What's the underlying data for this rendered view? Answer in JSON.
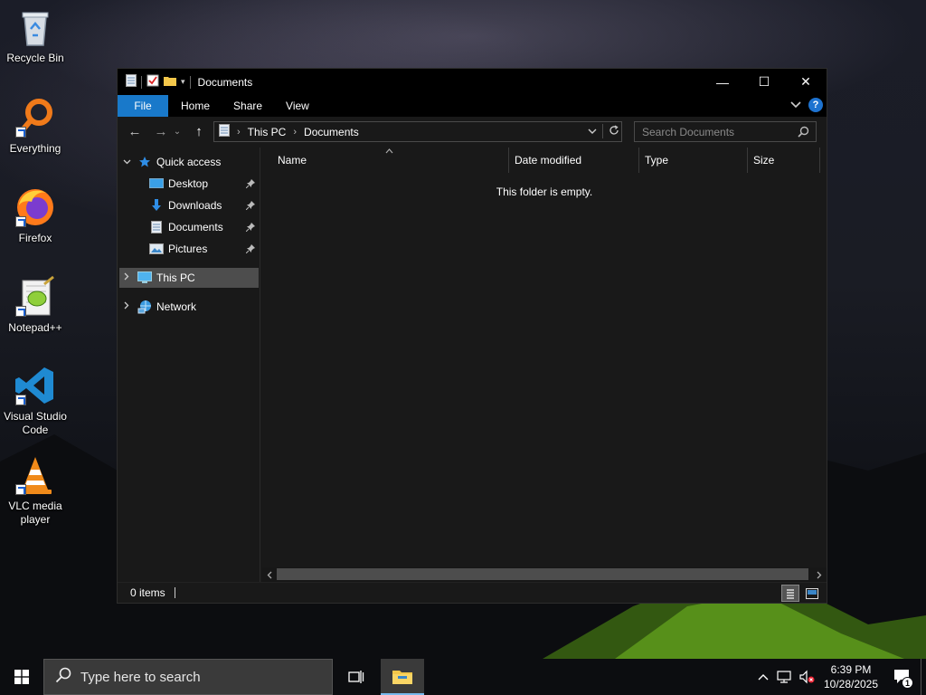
{
  "desktop": {
    "icons": [
      {
        "label": "Recycle Bin",
        "icon": "recycle-bin-icon"
      },
      {
        "label": "Everything",
        "icon": "everything-search-icon"
      },
      {
        "label": "Firefox",
        "icon": "firefox-icon"
      },
      {
        "label": "Notepad++",
        "icon": "notepad-plus-plus-icon"
      },
      {
        "label": "Visual Studio Code",
        "icon": "vscode-icon"
      },
      {
        "label": "VLC media player",
        "icon": "vlc-icon"
      }
    ]
  },
  "window": {
    "title": "Documents",
    "controls": {
      "minimize": "—",
      "maximize": "☐",
      "close": "✕"
    },
    "ribbon_tabs": [
      "File",
      "Home",
      "Share",
      "View"
    ],
    "nav": {
      "back": "←",
      "forward": "→",
      "recent": "⌄",
      "up": "↑"
    },
    "address": {
      "crumbs": [
        "This PC",
        "Documents"
      ],
      "separator": "›"
    },
    "search_placeholder": "Search Documents",
    "nav_pane": {
      "quick_access": "Quick access",
      "quick_items": [
        "Desktop",
        "Downloads",
        "Documents",
        "Pictures"
      ],
      "this_pc": "This PC",
      "network": "Network"
    },
    "columns": [
      "Name",
      "Date modified",
      "Type",
      "Size"
    ],
    "empty_message": "This folder is empty.",
    "status": {
      "items": "0 items"
    }
  },
  "taskbar": {
    "search_placeholder": "Type here to search",
    "time": "6:39 PM",
    "date": "10/28/2025",
    "notification_count": "1"
  },
  "colors": {
    "file_tab": "#1979ca",
    "selection": "#4d4d4d",
    "window_bg": "#191919",
    "taskbar_active": "#76b9ed"
  }
}
